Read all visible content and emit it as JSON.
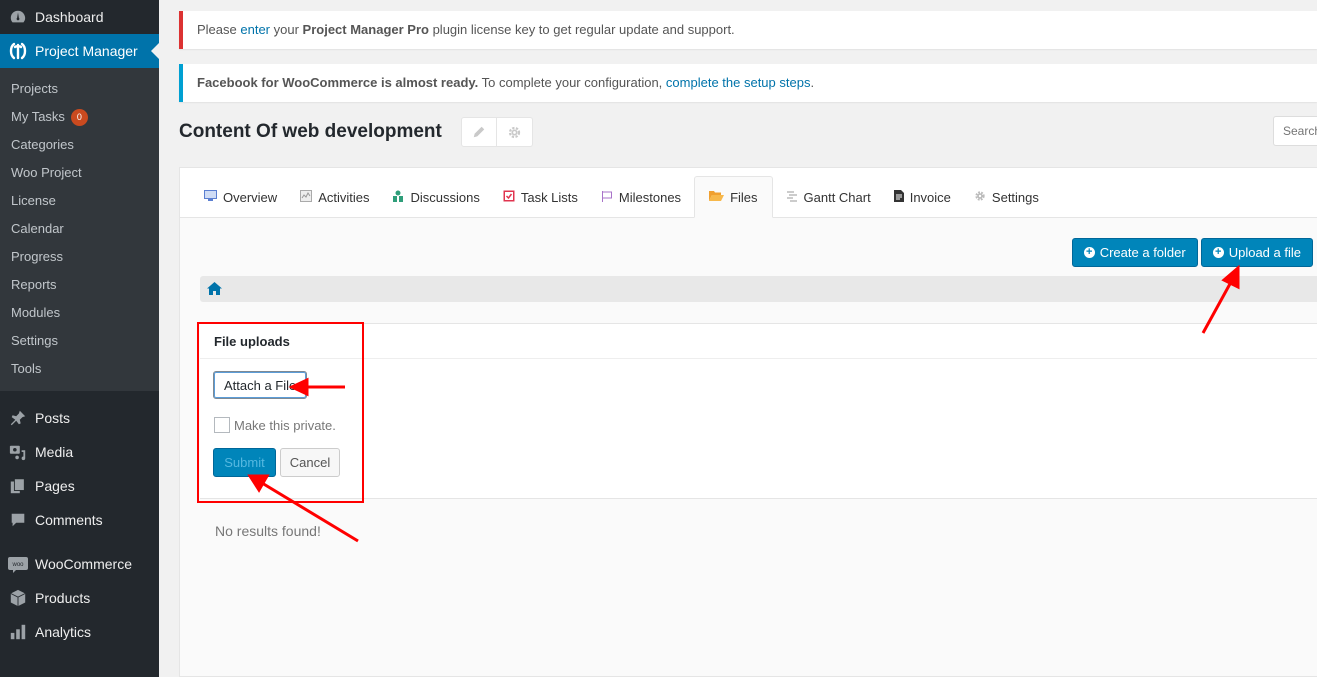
{
  "sidebar": {
    "top_items": [
      {
        "label": "Dashboard",
        "icon": "dashboard-icon"
      },
      {
        "label": "Project Manager",
        "icon": "project-manager-icon",
        "current": true
      }
    ],
    "submenu": [
      {
        "label": "Projects"
      },
      {
        "label": "My Tasks",
        "badge": "0"
      },
      {
        "label": "Categories"
      },
      {
        "label": "Woo Project"
      },
      {
        "label": "License"
      },
      {
        "label": "Calendar"
      },
      {
        "label": "Progress"
      },
      {
        "label": "Reports"
      },
      {
        "label": "Modules"
      },
      {
        "label": "Settings"
      },
      {
        "label": "Tools"
      }
    ],
    "bottom_items": [
      {
        "label": "Posts",
        "icon": "pin-icon"
      },
      {
        "label": "Media",
        "icon": "media-icon"
      },
      {
        "label": "Pages",
        "icon": "pages-icon"
      },
      {
        "label": "Comments",
        "icon": "comment-icon"
      },
      {
        "label": "WooCommerce",
        "icon": "woo-icon"
      },
      {
        "label": "Products",
        "icon": "box-icon"
      },
      {
        "label": "Analytics",
        "icon": "bar-chart-icon"
      }
    ]
  },
  "notices": {
    "license": {
      "prefix": "Please ",
      "link": "enter",
      "mid": " your ",
      "bold": "Project Manager Pro",
      "suffix": " plugin license key to get regular update and support."
    },
    "facebook": {
      "bold": "Facebook for WooCommerce is almost ready.",
      "text": " To complete your configuration, ",
      "link": "complete the setup steps",
      "suffix": "."
    }
  },
  "project": {
    "title": "Content Of web development",
    "search_placeholder": "Search"
  },
  "tabs": [
    {
      "label": "Overview",
      "icon": "overview-icon",
      "color": "#5b7fd1"
    },
    {
      "label": "Activities",
      "icon": "activities-icon",
      "color": "#aaaaaa"
    },
    {
      "label": "Discussions",
      "icon": "discussions-icon",
      "color": "#2f9e7a"
    },
    {
      "label": "Task Lists",
      "icon": "task-lists-icon",
      "color": "#e0344f"
    },
    {
      "label": "Milestones",
      "icon": "milestones-icon",
      "color": "#a873c9"
    },
    {
      "label": "Files",
      "icon": "folder-icon",
      "color": "#f0a030",
      "active": true
    },
    {
      "label": "Gantt Chart",
      "icon": "gantt-icon",
      "color": "#bbbbbb"
    },
    {
      "label": "Invoice",
      "icon": "invoice-icon",
      "color": "#333333"
    },
    {
      "label": "Settings",
      "icon": "gear-icon",
      "color": "#bbbbbb"
    }
  ],
  "files": {
    "create_folder_label": "Create a folder",
    "upload_file_label": "Upload a file",
    "upload_form": {
      "heading": "File uploads",
      "attach_label": "Attach a File",
      "private_label": "Make this private.",
      "private_checked": false,
      "submit_label": "Submit",
      "cancel_label": "Cancel"
    },
    "empty_message": "No results found!"
  },
  "colors": {
    "accent": "#0073aa",
    "button_primary": "#0085ba",
    "annotation": "#ff0000"
  }
}
